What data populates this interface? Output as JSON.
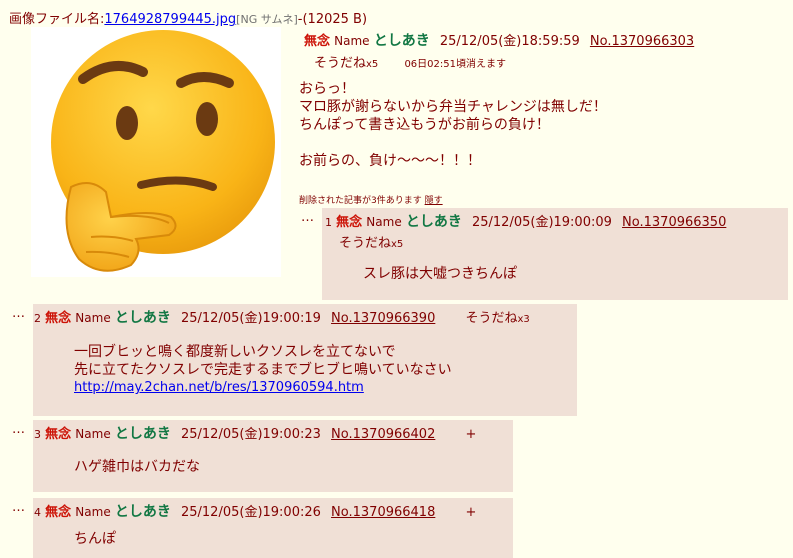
{
  "file": {
    "label": "画像ファイル名:",
    "filename": "1764928799445.jpg",
    "ng": "[NG サムネ]",
    "size": "-(12025 B)"
  },
  "op": {
    "subject": "無念",
    "name_label": "Name",
    "name": "としあき",
    "datetime": "25/12/05(金)18:59:59",
    "number": "No.1370966303",
    "sodane": "そうだね",
    "sodane_count": "x5",
    "expire": "06日02:51頃消えます",
    "body": [
      "おらっ！",
      "マロ豚が謝らないから弁当チャレンジは無しだ！",
      "ちんぽって書き込もうがお前らの負け！",
      "",
      "お前らの、負け〜〜〜！！！"
    ],
    "deleted_notice": "削除された記事が3件あります",
    "deleted_hide": "隠す"
  },
  "replies": [
    {
      "dots": "…",
      "index": "1",
      "subject": "無念",
      "name_label": "Name",
      "name": "としあき",
      "datetime": "25/12/05(金)19:00:09",
      "number": "No.1370966350",
      "sodane": "そうだね",
      "sodane_count": "x5",
      "body": [
        "スレ豚は大嘘つきちんぽ"
      ]
    },
    {
      "dots": "…",
      "index": "2",
      "subject": "無念",
      "name_label": "Name",
      "name": "としあき",
      "datetime": "25/12/05(金)19:00:19",
      "number": "No.1370966390",
      "sodane": "そうだね",
      "sodane_count": "x3",
      "body": [
        "一回ブヒッと鳴く都度新しいクソスレを立てないで",
        "先に立てたクソスレで完走するまでブヒブヒ鳴いていなさい"
      ],
      "link": "http://may.2chan.net/b/res/1370960594.htm"
    },
    {
      "dots": "…",
      "index": "3",
      "subject": "無念",
      "name_label": "Name",
      "name": "としあき",
      "datetime": "25/12/05(金)19:00:23",
      "number": "No.1370966402",
      "sodane": "+",
      "body": [
        "ハゲ雑巾はバカだな"
      ]
    },
    {
      "dots": "…",
      "index": "4",
      "subject": "無念",
      "name_label": "Name",
      "name": "としあき",
      "datetime": "25/12/05(金)19:00:26",
      "number": "No.1370966418",
      "sodane": "+",
      "body": [
        "ちんぽ"
      ]
    }
  ],
  "colors": {
    "background": "#ffffee",
    "reply_background": "#f0e0d6",
    "subject": "#cc1105",
    "name": "#117743",
    "text": "#800000",
    "link": "#0000ee"
  },
  "icons": {
    "thumbnail": "thinking-face-emoji-icon"
  }
}
